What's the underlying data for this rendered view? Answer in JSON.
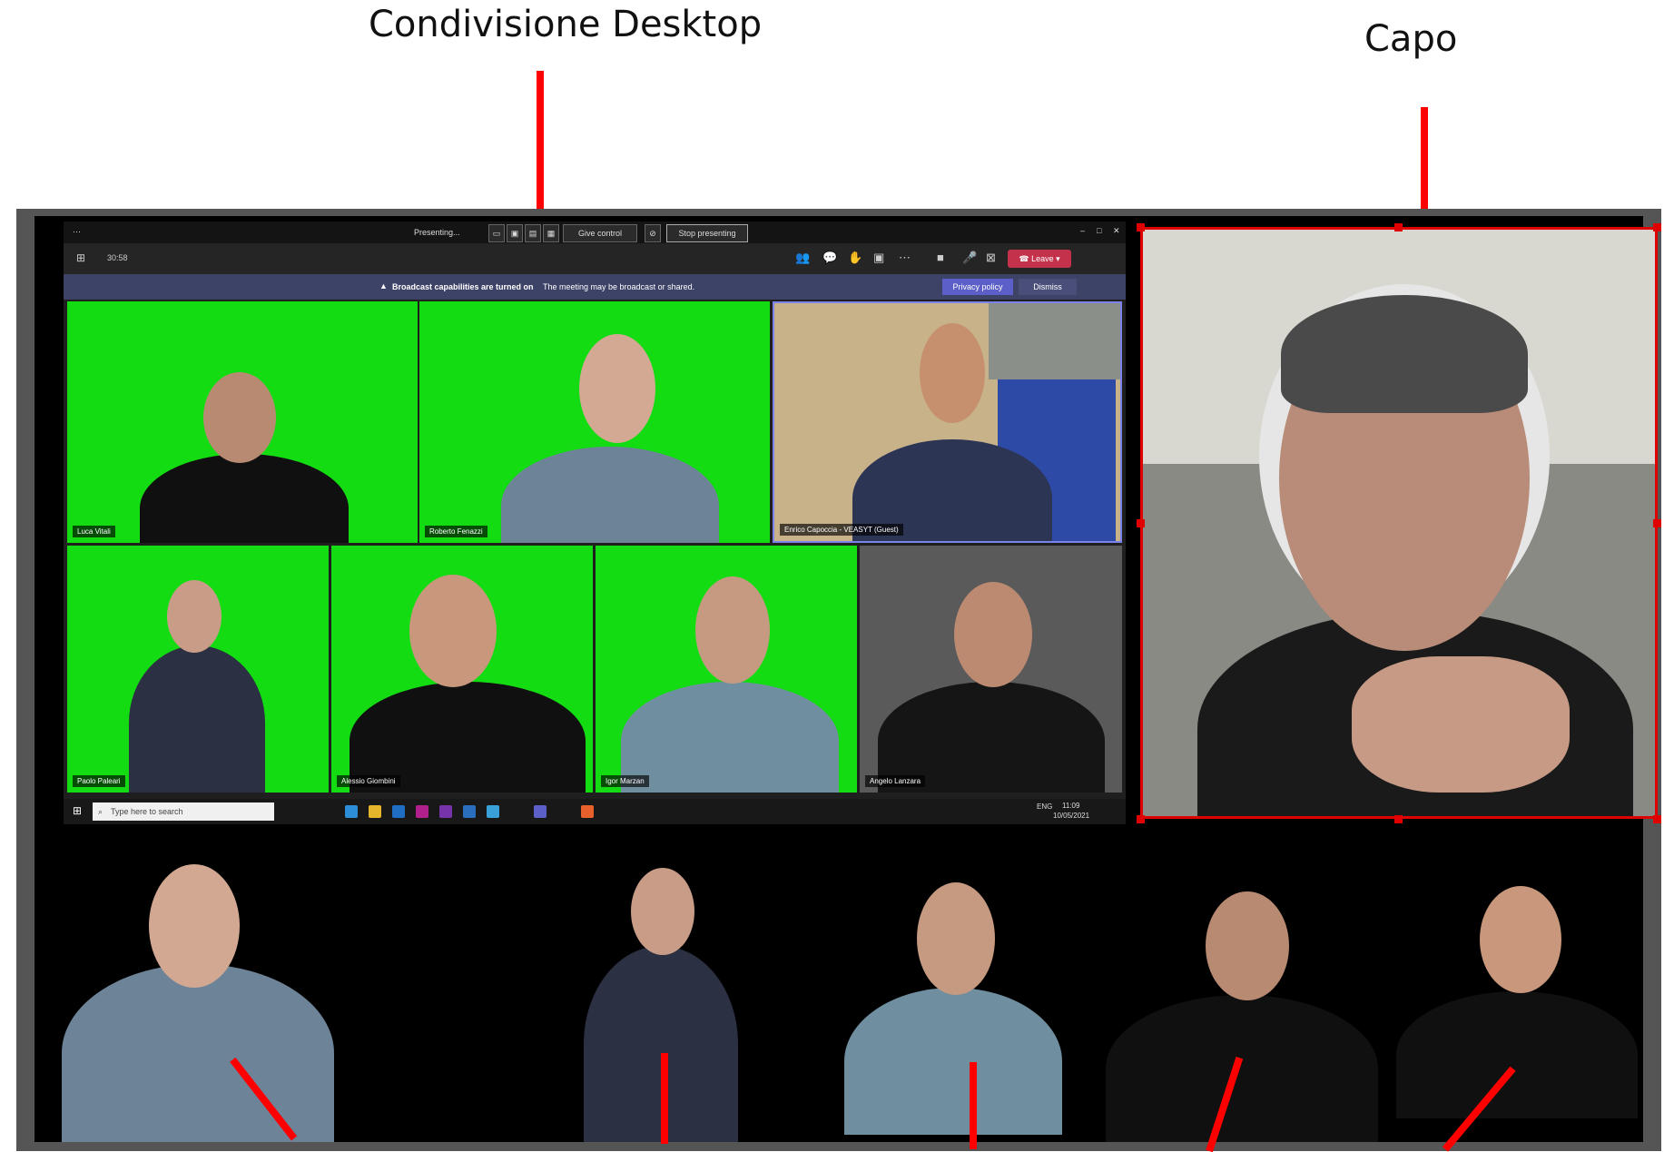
{
  "annotations": {
    "desktop_share": "Condivisione Desktop",
    "boss": "Capo"
  },
  "teams": {
    "status": "Presenting...",
    "give_control": "Give control",
    "stop_presenting": "Stop presenting",
    "timer": "30:58",
    "leave": "Leave",
    "banner_bold": "Broadcast capabilities are turned on",
    "banner_text": "The meeting may be broadcast or shared.",
    "privacy_policy": "Privacy policy",
    "dismiss": "Dismiss",
    "search_placeholder": "Type here to search",
    "tray_lang": "ENG",
    "tray_time": "11:09",
    "tray_date": "10/05/2021"
  },
  "participants": [
    {
      "name": "Luca Vitali"
    },
    {
      "name": "Roberto Fenazzi"
    },
    {
      "name": "Enrico Capoccia - VEASYT (Guest)"
    },
    {
      "name": "Paolo Paleari"
    },
    {
      "name": "Alessio Giombini"
    },
    {
      "name": "Igor Marzan"
    },
    {
      "name": "Angelo Lanzara"
    }
  ],
  "colors": {
    "green_screen": "#13dc13",
    "arrow": "#ff0000",
    "leave_button": "#c4314b",
    "banner": "#3d4267"
  },
  "icons": [
    "grid-icon",
    "people-icon",
    "chat-icon",
    "reactions-icon",
    "rooms-icon",
    "more-icon",
    "camera-icon",
    "mic-icon",
    "share-icon",
    "phone-icon",
    "windows-start-icon",
    "search-icon"
  ]
}
